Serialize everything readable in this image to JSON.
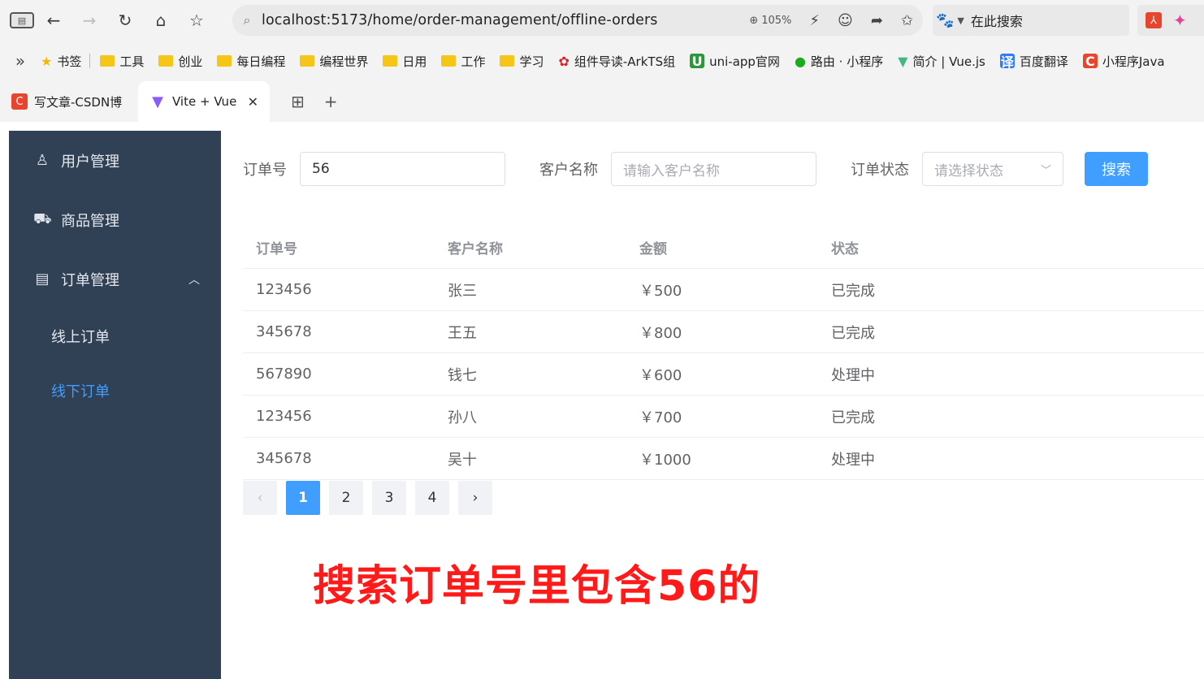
{
  "browser": {
    "url": "localhost:5173/home/order-management/offline-orders",
    "zoom": "105%",
    "search_box": "在此搜索",
    "bookmarks": [
      "书签",
      "工具",
      "创业",
      "每日编程",
      "编程世界",
      "日用",
      "工作",
      "学习",
      "组件导读-ArkTS组",
      "uni-app官网",
      "路由 · 小程序",
      "简介 | Vue.js",
      "百度翻译",
      "小程序Java"
    ],
    "tabs": [
      {
        "title": "写文章-CSDN博"
      },
      {
        "title": "Vite + Vue"
      }
    ]
  },
  "sidebar": {
    "items": [
      {
        "label": "用户管理"
      },
      {
        "label": "商品管理"
      },
      {
        "label": "订单管理"
      }
    ],
    "subitems": [
      {
        "label": "线上订单"
      },
      {
        "label": "线下订单"
      }
    ]
  },
  "filters": {
    "order_no_label": "订单号",
    "order_no_value": "56",
    "customer_label": "客户名称",
    "customer_placeholder": "请输入客户名称",
    "status_label": "订单状态",
    "status_placeholder": "请选择状态",
    "search_button": "搜索"
  },
  "table": {
    "columns": [
      "订单号",
      "客户名称",
      "金额",
      "状态"
    ],
    "rows": [
      [
        "123456",
        "张三",
        "￥500",
        "已完成"
      ],
      [
        "345678",
        "王五",
        "￥800",
        "已完成"
      ],
      [
        "567890",
        "钱七",
        "￥600",
        "处理中"
      ],
      [
        "123456",
        "孙八",
        "￥700",
        "已完成"
      ],
      [
        "345678",
        "吴十",
        "￥1000",
        "处理中"
      ]
    ]
  },
  "pagination": {
    "pages": [
      "1",
      "2",
      "3",
      "4"
    ],
    "current": "1"
  },
  "annotation": "搜索订单号里包含56的",
  "colors": {
    "sidebar_bg": "#304156",
    "accent": "#409eff",
    "annotation": "#ff1a1a"
  }
}
